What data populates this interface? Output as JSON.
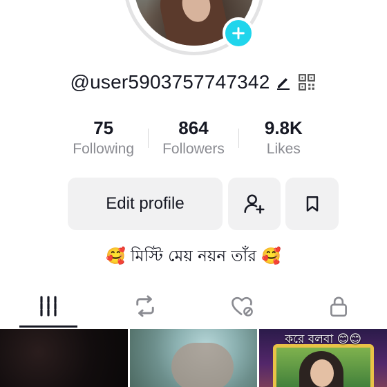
{
  "profile": {
    "username": "@user5903757747342",
    "bio": "🥰 মিস্টি মেয় নয়ন তাঁর 🥰"
  },
  "stats": [
    {
      "value": "75",
      "label": "Following"
    },
    {
      "value": "864",
      "label": "Followers"
    },
    {
      "value": "9.8K",
      "label": "Likes"
    }
  ],
  "actions": {
    "edit_profile_label": "Edit profile"
  },
  "tabs": [
    {
      "icon": "grid-icon",
      "active": true
    },
    {
      "icon": "repost-icon",
      "active": false
    },
    {
      "icon": "liked-heart-icon",
      "active": false
    },
    {
      "icon": "lock-icon",
      "active": false
    }
  ],
  "videos": [
    {
      "caption": ""
    },
    {
      "caption": ""
    },
    {
      "caption": "করে বলবা 😊😊"
    }
  ],
  "colors": {
    "accent": "#20d5ec",
    "text": "#161823",
    "muted": "#8a8b91",
    "button_bg": "#f1f1f2"
  }
}
